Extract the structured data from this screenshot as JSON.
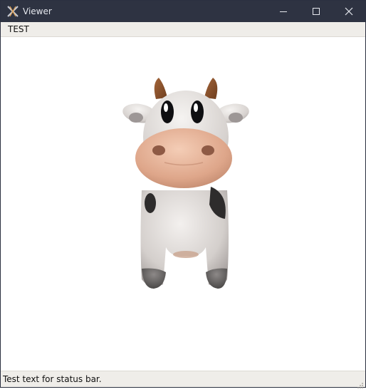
{
  "window": {
    "title": "Viewer",
    "app_icon": "app-logo-icon",
    "controls": [
      "minimize-icon",
      "maximize-icon",
      "close-icon"
    ]
  },
  "menubar": {
    "items": [
      {
        "label": "TEST"
      }
    ]
  },
  "viewport": {
    "content": "3d-cow-model",
    "background": "#ffffff"
  },
  "statusbar": {
    "text": "Test text for status bar."
  },
  "colors": {
    "titlebar": "#2e3342",
    "menubar": "#efede9",
    "statusbar": "#efede9"
  }
}
